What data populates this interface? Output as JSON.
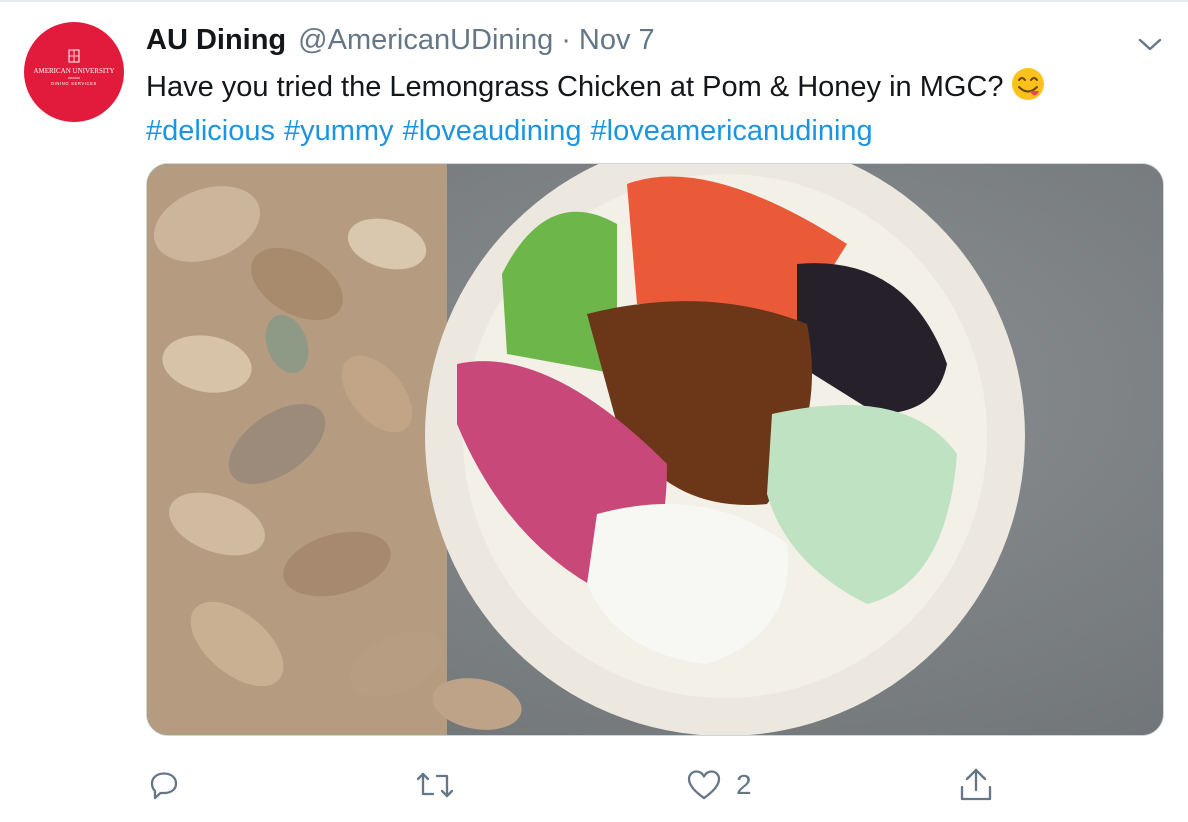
{
  "tweet": {
    "author": {
      "name": "AU Dining",
      "handle": "@AmericanUDining",
      "avatar_text": "AMERICAN UNIVERSITY",
      "avatar_subtext": "DINING SERVICES",
      "avatar_color": "#e21a3b"
    },
    "separator": "·",
    "date": "Nov 7",
    "text": "Have you tried the Lemongrass Chicken at Pom & Honey in MGC?",
    "emoji": "face-savoring-food-emoji",
    "hashtags": [
      "#delicious",
      "#yummy",
      "#loveaudining",
      "#loveamericanudining"
    ],
    "image": "photo-grain-bowl",
    "actions": {
      "reply_icon": "reply-icon",
      "retweet_icon": "retweet-icon",
      "like_icon": "heart-icon",
      "like_count": "2",
      "share_icon": "share-icon"
    },
    "colors": {
      "hashtag": "#1b95e0",
      "secondary_text": "#657786",
      "primary_text": "#14171a"
    }
  }
}
